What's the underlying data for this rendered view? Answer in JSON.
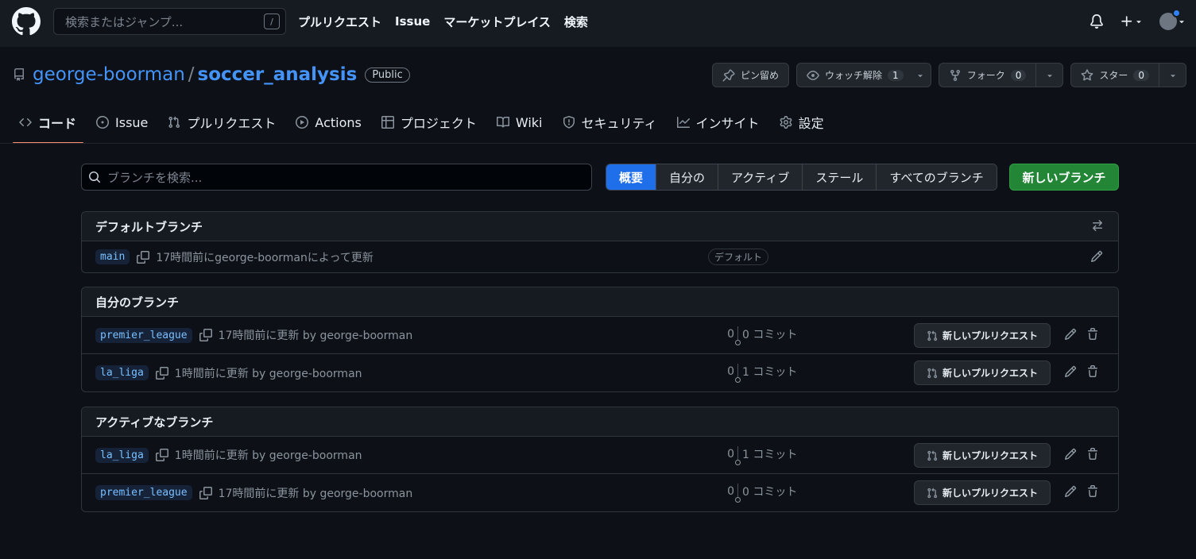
{
  "header": {
    "search_placeholder": "検索またはジャンプ...",
    "search_shortcut": "/",
    "nav": [
      "プルリクエスト",
      "Issue",
      "マーケットプレイス",
      "検索"
    ]
  },
  "repo": {
    "owner": "george-boorman",
    "separator": "/",
    "name": "soccer_analysis",
    "visibility": "Public",
    "pin_label": "ピン留め",
    "watch_label": "ウォッチ解除",
    "watch_count": "1",
    "fork_label": "フォーク",
    "fork_count": "0",
    "star_label": "スター",
    "star_count": "0"
  },
  "tabs": [
    {
      "label": "コード",
      "icon": "code-icon",
      "selected": true
    },
    {
      "label": "Issue",
      "icon": "issue-opened-icon"
    },
    {
      "label": "プルリクエスト",
      "icon": "git-pull-request-icon"
    },
    {
      "label": "Actions",
      "icon": "play-icon"
    },
    {
      "label": "プロジェクト",
      "icon": "table-icon"
    },
    {
      "label": "Wiki",
      "icon": "book-icon"
    },
    {
      "label": "セキュリティ",
      "icon": "shield-icon"
    },
    {
      "label": "インサイト",
      "icon": "graph-icon"
    },
    {
      "label": "設定",
      "icon": "gear-icon"
    }
  ],
  "branches": {
    "search_placeholder": "ブランチを検索...",
    "filters": [
      "概要",
      "自分の",
      "アクティブ",
      "ステール",
      "すべてのブランチ"
    ],
    "active_filter": "概要",
    "new_branch_label": "新しいブランチ",
    "new_pr_label": "新しいプルリクエスト",
    "default_section": {
      "title": "デフォルトブランチ",
      "row": {
        "name": "main",
        "meta": "17時間前にgeorge-boormanによって更新",
        "badge": "デフォルト"
      }
    },
    "my_section": {
      "title": "自分のブランチ",
      "rows": [
        {
          "name": "premier_league",
          "meta": "17時間前に更新 by george-boorman",
          "behind": "0",
          "ahead": "0 コミット"
        },
        {
          "name": "la_liga",
          "meta": "1時間前に更新 by george-boorman",
          "behind": "0",
          "ahead": "1 コミット"
        }
      ]
    },
    "active_section": {
      "title": "アクティブなブランチ",
      "rows": [
        {
          "name": "la_liga",
          "meta": "1時間前に更新 by george-boorman",
          "behind": "0",
          "ahead": "1 コミット"
        },
        {
          "name": "premier_league",
          "meta": "17時間前に更新 by george-boorman",
          "behind": "0",
          "ahead": "0 コミット"
        }
      ]
    }
  },
  "colors": {
    "background": "#0d1117",
    "header": "#161b22",
    "link": "#4493f8",
    "accent_blue": "#1f6feb",
    "accent_green": "#238636",
    "tab_underline": "#fd8c73"
  }
}
